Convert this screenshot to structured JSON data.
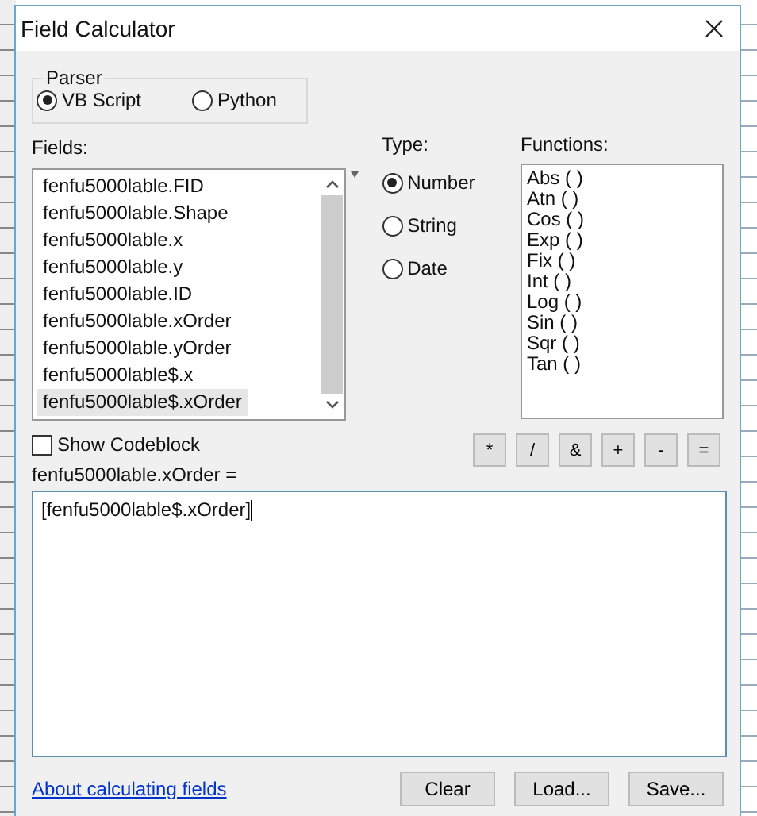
{
  "window": {
    "title": "Field Calculator"
  },
  "parser": {
    "label": "Parser",
    "options": [
      {
        "label": "VB Script",
        "selected": true
      },
      {
        "label": "Python",
        "selected": false
      }
    ]
  },
  "fields": {
    "label": "Fields:",
    "items": [
      {
        "label": "fenfu5000lable.FID",
        "selected": false
      },
      {
        "label": "fenfu5000lable.Shape",
        "selected": false
      },
      {
        "label": "fenfu5000lable.x",
        "selected": false
      },
      {
        "label": "fenfu5000lable.y",
        "selected": false
      },
      {
        "label": "fenfu5000lable.ID",
        "selected": false
      },
      {
        "label": "fenfu5000lable.xOrder",
        "selected": false
      },
      {
        "label": "fenfu5000lable.yOrder",
        "selected": false
      },
      {
        "label": "fenfu5000lable$.x",
        "selected": false
      },
      {
        "label": "fenfu5000lable$.xOrder",
        "selected": true
      }
    ]
  },
  "type": {
    "label": "Type:",
    "options": [
      {
        "label": "Number",
        "selected": true
      },
      {
        "label": "String",
        "selected": false
      },
      {
        "label": "Date",
        "selected": false
      }
    ]
  },
  "functions": {
    "label": "Functions:",
    "items": [
      "Abs ( )",
      "Atn ( )",
      "Cos ( )",
      "Exp ( )",
      "Fix ( )",
      "Int ( )",
      "Log ( )",
      "Sin ( )",
      "Sqr ( )",
      "Tan ( )"
    ]
  },
  "show_codeblock": {
    "label": "Show Codeblock",
    "checked": false
  },
  "operators": [
    "*",
    "/",
    "&",
    "+",
    "-",
    "="
  ],
  "expression": {
    "label": "fenfu5000lable.xOrder =",
    "value": "[fenfu5000lable$.xOrder]"
  },
  "help_link": "About calculating fields",
  "buttons": [
    "Clear",
    "Load...",
    "Save..."
  ]
}
